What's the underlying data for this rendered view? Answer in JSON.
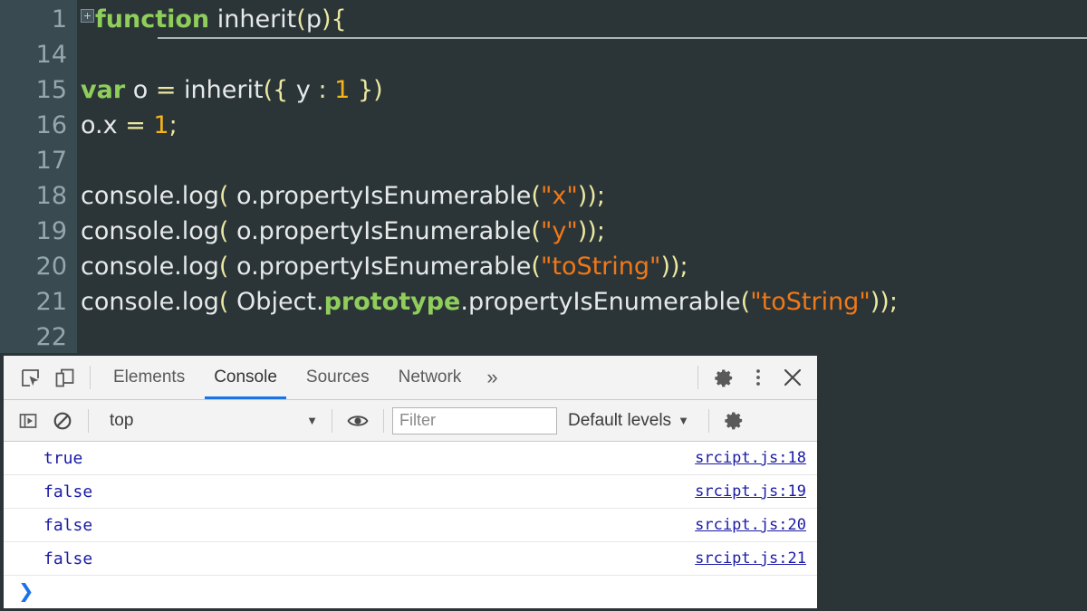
{
  "editor": {
    "lines": [
      {
        "num": "1",
        "fold": true,
        "tokens": [
          {
            "t": "function",
            "c": "kw"
          },
          {
            "t": " ",
            "c": "pln"
          },
          {
            "t": "inherit",
            "c": "pln"
          },
          {
            "t": "(",
            "c": "op"
          },
          {
            "t": "p",
            "c": "pln"
          },
          {
            "t": ")",
            "c": "op"
          },
          {
            "t": "{",
            "c": "op"
          }
        ]
      },
      {
        "num": "14",
        "fold": false,
        "tokens": []
      },
      {
        "num": "15",
        "fold": false,
        "tokens": [
          {
            "t": "var",
            "c": "kw"
          },
          {
            "t": " o ",
            "c": "pln"
          },
          {
            "t": "=",
            "c": "op"
          },
          {
            "t": " ",
            "c": "pln"
          },
          {
            "t": "inherit",
            "c": "pln"
          },
          {
            "t": "({",
            "c": "op"
          },
          {
            "t": " y ",
            "c": "pln"
          },
          {
            "t": ":",
            "c": "op"
          },
          {
            "t": " ",
            "c": "pln"
          },
          {
            "t": "1",
            "c": "num"
          },
          {
            "t": " })",
            "c": "op"
          }
        ]
      },
      {
        "num": "16",
        "fold": false,
        "tokens": [
          {
            "t": "o.x ",
            "c": "pln"
          },
          {
            "t": "=",
            "c": "op"
          },
          {
            "t": " ",
            "c": "pln"
          },
          {
            "t": "1",
            "c": "num"
          },
          {
            "t": ";",
            "c": "op"
          }
        ]
      },
      {
        "num": "17",
        "fold": false,
        "tokens": []
      },
      {
        "num": "18",
        "fold": false,
        "tokens": [
          {
            "t": "console.log",
            "c": "pln"
          },
          {
            "t": "(",
            "c": "op"
          },
          {
            "t": " o.propertyIsEnumerable",
            "c": "pln"
          },
          {
            "t": "(",
            "c": "op"
          },
          {
            "t": "\"x\"",
            "c": "str"
          },
          {
            "t": "));",
            "c": "op"
          }
        ]
      },
      {
        "num": "19",
        "fold": false,
        "tokens": [
          {
            "t": "console.log",
            "c": "pln"
          },
          {
            "t": "(",
            "c": "op"
          },
          {
            "t": " o.propertyIsEnumerable",
            "c": "pln"
          },
          {
            "t": "(",
            "c": "op"
          },
          {
            "t": "\"y\"",
            "c": "str"
          },
          {
            "t": "));",
            "c": "op"
          }
        ]
      },
      {
        "num": "20",
        "fold": false,
        "tokens": [
          {
            "t": "console.log",
            "c": "pln"
          },
          {
            "t": "(",
            "c": "op"
          },
          {
            "t": " o.propertyIsEnumerable",
            "c": "pln"
          },
          {
            "t": "(",
            "c": "op"
          },
          {
            "t": "\"toString\"",
            "c": "str"
          },
          {
            "t": "));",
            "c": "op"
          }
        ]
      },
      {
        "num": "21",
        "fold": false,
        "tokens": [
          {
            "t": "console.log",
            "c": "pln"
          },
          {
            "t": "(",
            "c": "op"
          },
          {
            "t": " Object.",
            "c": "pln"
          },
          {
            "t": "prototype",
            "c": "kw"
          },
          {
            "t": ".propertyIsEnumerable",
            "c": "pln"
          },
          {
            "t": "(",
            "c": "op"
          },
          {
            "t": "\"toString\"",
            "c": "str"
          },
          {
            "t": "));",
            "c": "op"
          }
        ]
      },
      {
        "num": "22",
        "fold": false,
        "tokens": []
      }
    ],
    "colors": {
      "background": "#2b3538",
      "gutter": "#3a4a51",
      "line_number": "#93a8ae",
      "keyword": "#8fce5b",
      "operator": "#ece8a0",
      "number": "#f5b417",
      "string": "#f07818",
      "plain": "#e6e9e8"
    }
  },
  "devtools": {
    "toolbar": {
      "inspect_icon": "inspect-element-icon",
      "device_icon": "device-toolbar-icon",
      "tabs": [
        {
          "label": "Elements",
          "active": false
        },
        {
          "label": "Console",
          "active": true
        },
        {
          "label": "Sources",
          "active": false
        },
        {
          "label": "Network",
          "active": false
        }
      ],
      "more_tabs_glyph": "»",
      "settings_icon": "gear-icon",
      "menu_icon": "more-vertical-icon",
      "close_icon": "close-icon"
    },
    "filterbar": {
      "sidebar_toggle_icon": "console-sidebar-icon",
      "clear_icon": "clear-console-icon",
      "context": "top",
      "context_caret": "▼",
      "eye_icon": "live-expression-icon",
      "filter_placeholder": "Filter",
      "filter_value": "",
      "levels_label": "Default levels",
      "levels_caret": "▼",
      "settings_icon": "console-settings-gear-icon"
    },
    "console": {
      "messages": [
        {
          "value": "true",
          "source": "srcipt.js:18"
        },
        {
          "value": "false",
          "source": "srcipt.js:19"
        },
        {
          "value": "false",
          "source": "srcipt.js:20"
        },
        {
          "value": "false",
          "source": "srcipt.js:21"
        }
      ],
      "prompt_glyph": "❯"
    },
    "colors": {
      "chrome": "#f3f3f3",
      "accent": "#1a73e8",
      "value_text": "#1a1aa6",
      "border": "#cacaca"
    }
  }
}
